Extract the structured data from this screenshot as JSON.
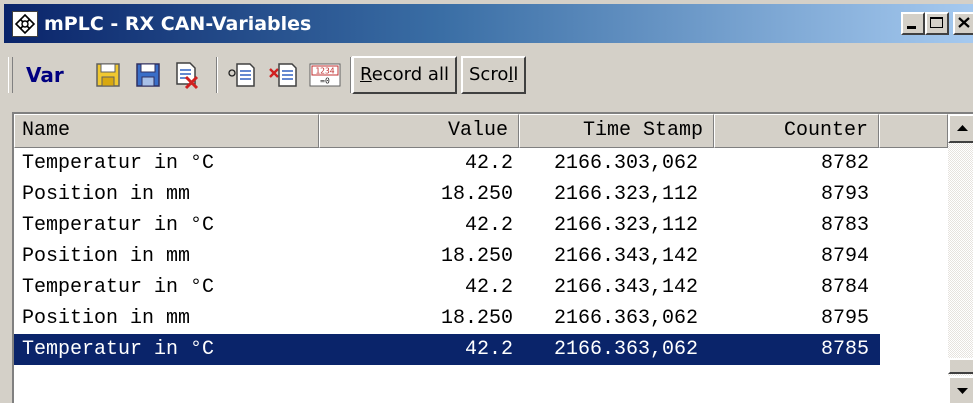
{
  "window": {
    "title": "mPLC - RX CAN-Variables",
    "title_color": "#0a246a"
  },
  "toolbar": {
    "var_label": "Var",
    "record_all_underlined": "R",
    "record_all_rest": "ecord all",
    "scroll_start": "Scro",
    "scroll_underlined": "l",
    "scroll_end": "l",
    "icons": [
      "open-yellow-icon",
      "save-icon",
      "delete-doc-icon",
      "add-doc-icon",
      "clear-doc-icon",
      "reset-counter-icon"
    ],
    "reset_icon_top": "1234",
    "reset_icon_bottom": "=0"
  },
  "table": {
    "columns": [
      "Name",
      "Value",
      "Time Stamp",
      "Counter"
    ],
    "rows": [
      {
        "name": "Temperatur in °C",
        "value": "42.2",
        "time_stamp": "2166.303,062",
        "counter": "8782"
      },
      {
        "name": "Position in mm",
        "value": "18.250",
        "time_stamp": "2166.323,112",
        "counter": "8793"
      },
      {
        "name": "Temperatur in °C",
        "value": "42.2",
        "time_stamp": "2166.323,112",
        "counter": "8783"
      },
      {
        "name": "Position in mm",
        "value": "18.250",
        "time_stamp": "2166.343,142",
        "counter": "8794"
      },
      {
        "name": "Temperatur in °C",
        "value": "42.2",
        "time_stamp": "2166.343,142",
        "counter": "8784"
      },
      {
        "name": "Position in mm",
        "value": "18.250",
        "time_stamp": "2166.363,062",
        "counter": "8795"
      },
      {
        "name": "Temperatur in °C",
        "value": "42.2",
        "time_stamp": "2166.363,062",
        "counter": "8785"
      }
    ],
    "selected_row": 6,
    "selection_color": "#0a246a"
  }
}
